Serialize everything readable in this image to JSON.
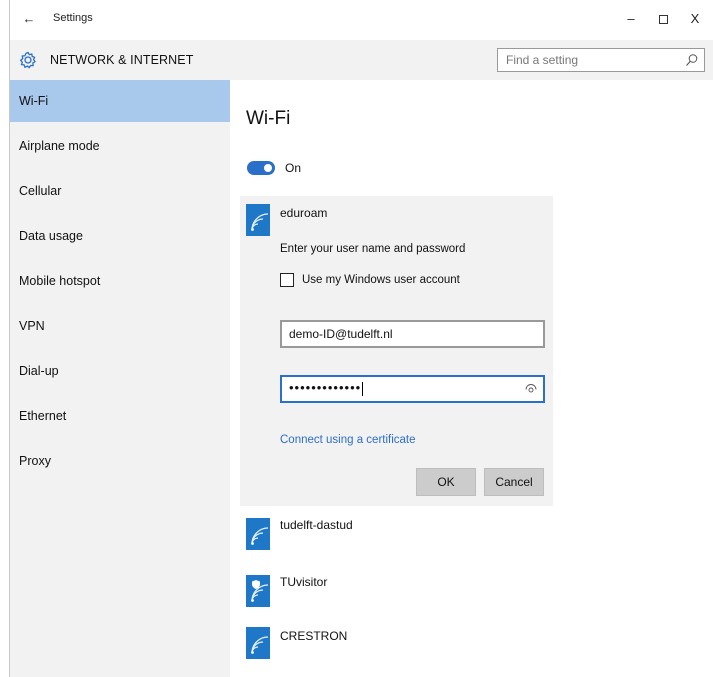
{
  "window": {
    "title": "Settings",
    "back_label": "←",
    "minimize_label": "–",
    "close_label": "X"
  },
  "header": {
    "title": "NETWORK & INTERNET",
    "icon": "gear-icon",
    "search_placeholder": "Find a setting"
  },
  "sidebar": {
    "items": [
      {
        "label": "Wi-Fi",
        "active": true
      },
      {
        "label": "Airplane mode"
      },
      {
        "label": "Cellular"
      },
      {
        "label": "Data usage"
      },
      {
        "label": "Mobile hotspot"
      },
      {
        "label": "VPN"
      },
      {
        "label": "Dial-up"
      },
      {
        "label": "Ethernet"
      },
      {
        "label": "Proxy"
      }
    ]
  },
  "main": {
    "title": "Wi-Fi",
    "toggle_label": "On",
    "toggle_on": true,
    "connecting": {
      "name": "eduroam",
      "prompt": "Enter your user name and password",
      "checkbox_label": "Use my Windows user account",
      "username_value": "demo-ID@tudelft.nl",
      "password_value": "•••••••••••••",
      "cert_link": "Connect using a certificate",
      "ok_label": "OK",
      "cancel_label": "Cancel"
    },
    "networks": [
      {
        "name": "tudelft-dastud",
        "secured": false
      },
      {
        "name": "TUvisitor",
        "secured": true
      },
      {
        "name": "CRESTRON",
        "secured": false
      }
    ]
  },
  "colors": {
    "accent": "#2a6fc9",
    "sidebar_active": "#a8c8ec",
    "wifi_tile": "#1e78c7",
    "panel_bg": "#f2f2f2"
  }
}
